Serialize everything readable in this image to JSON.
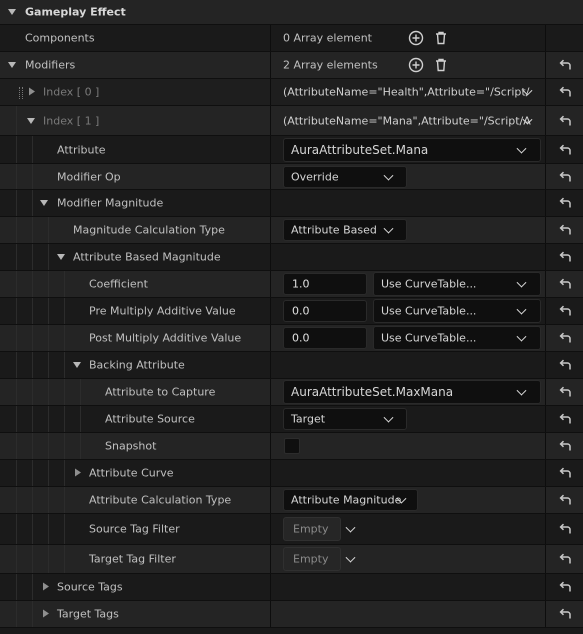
{
  "section": {
    "title": "Gameplay Effect"
  },
  "components": {
    "label": "Components",
    "value": "0 Array element"
  },
  "modifiers": {
    "label": "Modifiers",
    "value": "2 Array elements",
    "index0": {
      "label": "Index [ 0 ]",
      "value": "(AttributeName=\"Health\",Attribute=\"/Script/"
    },
    "index1": {
      "label": "Index [ 1 ]",
      "value": "(AttributeName=\"Mana\",Attribute=\"/Script/A"
    }
  },
  "attribute": {
    "label": "Attribute",
    "value": "AuraAttributeSet.Mana"
  },
  "modifier_op": {
    "label": "Modifier Op",
    "value": "Override"
  },
  "modifier_magnitude": {
    "label": "Modifier Magnitude"
  },
  "magnitude_calc_type": {
    "label": "Magnitude Calculation Type",
    "value": "Attribute Based"
  },
  "attribute_based_magnitude": {
    "label": "Attribute Based Magnitude"
  },
  "coefficient": {
    "label": "Coefficient",
    "value": "1.0",
    "curve": "Use CurveTable..."
  },
  "pre_multiply": {
    "label": "Pre Multiply Additive Value",
    "value": "0.0",
    "curve": "Use CurveTable..."
  },
  "post_multiply": {
    "label": "Post Multiply Additive Value",
    "value": "0.0",
    "curve": "Use CurveTable..."
  },
  "backing_attribute": {
    "label": "Backing Attribute"
  },
  "attribute_to_capture": {
    "label": "Attribute to Capture",
    "value": "AuraAttributeSet.MaxMana"
  },
  "attribute_source": {
    "label": "Attribute Source",
    "value": "Target"
  },
  "snapshot": {
    "label": "Snapshot",
    "checked": false
  },
  "attribute_curve": {
    "label": "Attribute Curve"
  },
  "attribute_calc_type": {
    "label": "Attribute Calculation Type",
    "value": "Attribute Magnitude"
  },
  "source_tag_filter": {
    "label": "Source Tag Filter",
    "value": "Empty"
  },
  "target_tag_filter": {
    "label": "Target Tag Filter",
    "value": "Empty"
  },
  "source_tags": {
    "label": "Source Tags"
  },
  "target_tags": {
    "label": "Target Tags"
  },
  "icons": {
    "expand": "chevron-down-icon",
    "collapse": "chevron-right-icon",
    "add": "plus-circle-icon",
    "delete": "trash-icon",
    "reset": "reset-arrow-icon",
    "drag": "drag-handle-icon"
  },
  "colors": {
    "background": "#151515",
    "row_dark": "#1a1a1a",
    "row_light": "#242424",
    "input_bg": "#0f0f0f",
    "text": "#c0c0c0",
    "text_muted": "#7a7a7a"
  }
}
